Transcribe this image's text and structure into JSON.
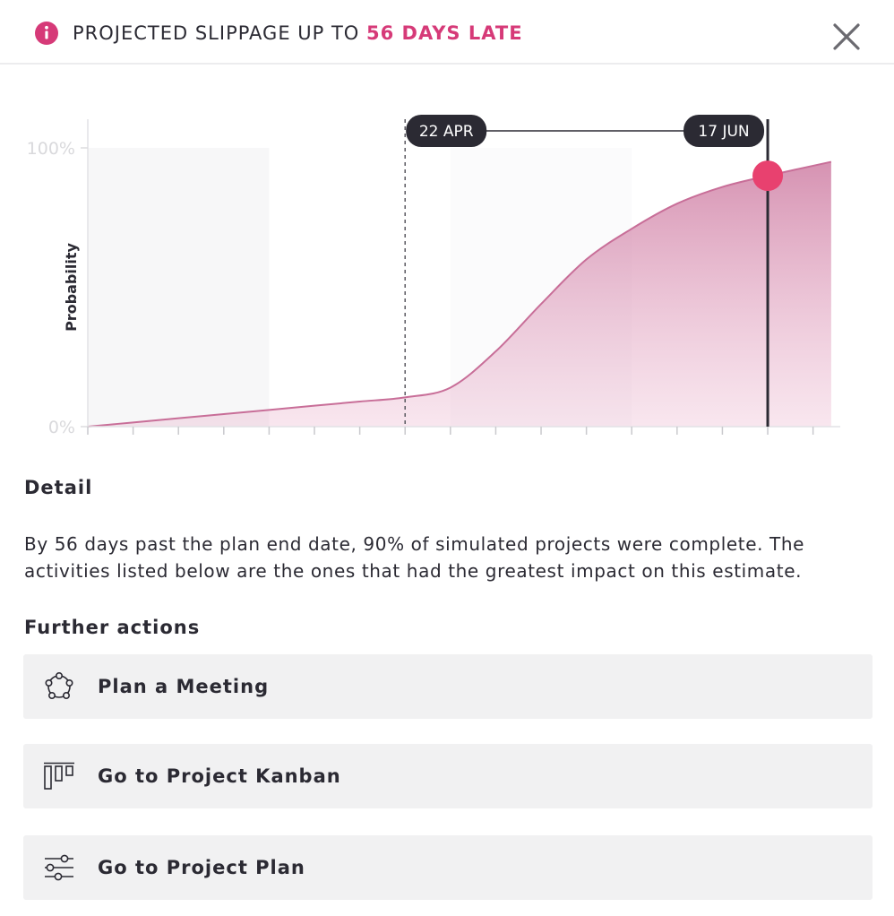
{
  "header": {
    "title_prefix": "PROJECTED SLIPPAGE UP TO ",
    "title_highlight": "56 DAYS LATE",
    "info_icon": "info-icon",
    "close_icon": "close-icon"
  },
  "colors": {
    "accent": "#d63a78",
    "marker": "#e8416f",
    "label_bg": "#2b2a33",
    "curve": "#c86e98",
    "text": "#2b2a33",
    "action_bg": "#f1f1f2"
  },
  "chart_data": {
    "type": "area",
    "ylabel": "Probability",
    "y_ticks": [
      "100%",
      "0%"
    ],
    "ylim": [
      0,
      100
    ],
    "x_tick_count": 17,
    "plan_end_label": "22 APR",
    "projected_label": "17 JUN",
    "projected_probability": 90,
    "plan_end_probability": 10,
    "grid": false,
    "series": [
      {
        "x": [
          0,
          1,
          2,
          3,
          4,
          5,
          6,
          7,
          8,
          9,
          10,
          11,
          12,
          13,
          14,
          15,
          16.4
        ],
        "values": [
          0,
          1.5,
          3,
          4.5,
          6,
          7.5,
          9,
          10.5,
          14,
          27,
          44,
          60,
          71,
          80,
          86,
          90,
          95
        ]
      }
    ]
  },
  "detail": {
    "heading": "Detail",
    "text": "By 56 days past the plan end date, 90% of simulated projects were complete. The activities listed below are the ones that had the greatest impact on this estimate."
  },
  "actions": {
    "heading": "Further actions",
    "items": [
      {
        "label": "Plan a Meeting",
        "icon": "meeting-icon"
      },
      {
        "label": "Go to Project Kanban",
        "icon": "kanban-icon"
      },
      {
        "label": "Go to Project Plan",
        "icon": "plan-icon"
      }
    ]
  }
}
